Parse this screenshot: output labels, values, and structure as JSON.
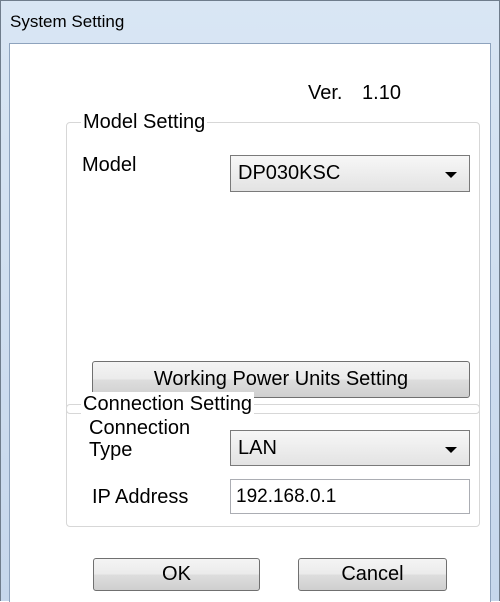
{
  "window": {
    "title": "System Setting"
  },
  "version": {
    "label": "Ver.",
    "value": "1.10"
  },
  "model_setting": {
    "legend": "Model Setting",
    "model_label": "Model",
    "model_value": "DP030KSC",
    "working_units_button": "Working Power Units Setting"
  },
  "connection_setting": {
    "legend": "Connection Setting",
    "type_label_line1": "Connection",
    "type_label_line2": "Type",
    "type_value": "LAN",
    "ip_label": "IP Address",
    "ip_value": "192.168.0.1"
  },
  "buttons": {
    "ok": "OK",
    "cancel": "Cancel"
  }
}
